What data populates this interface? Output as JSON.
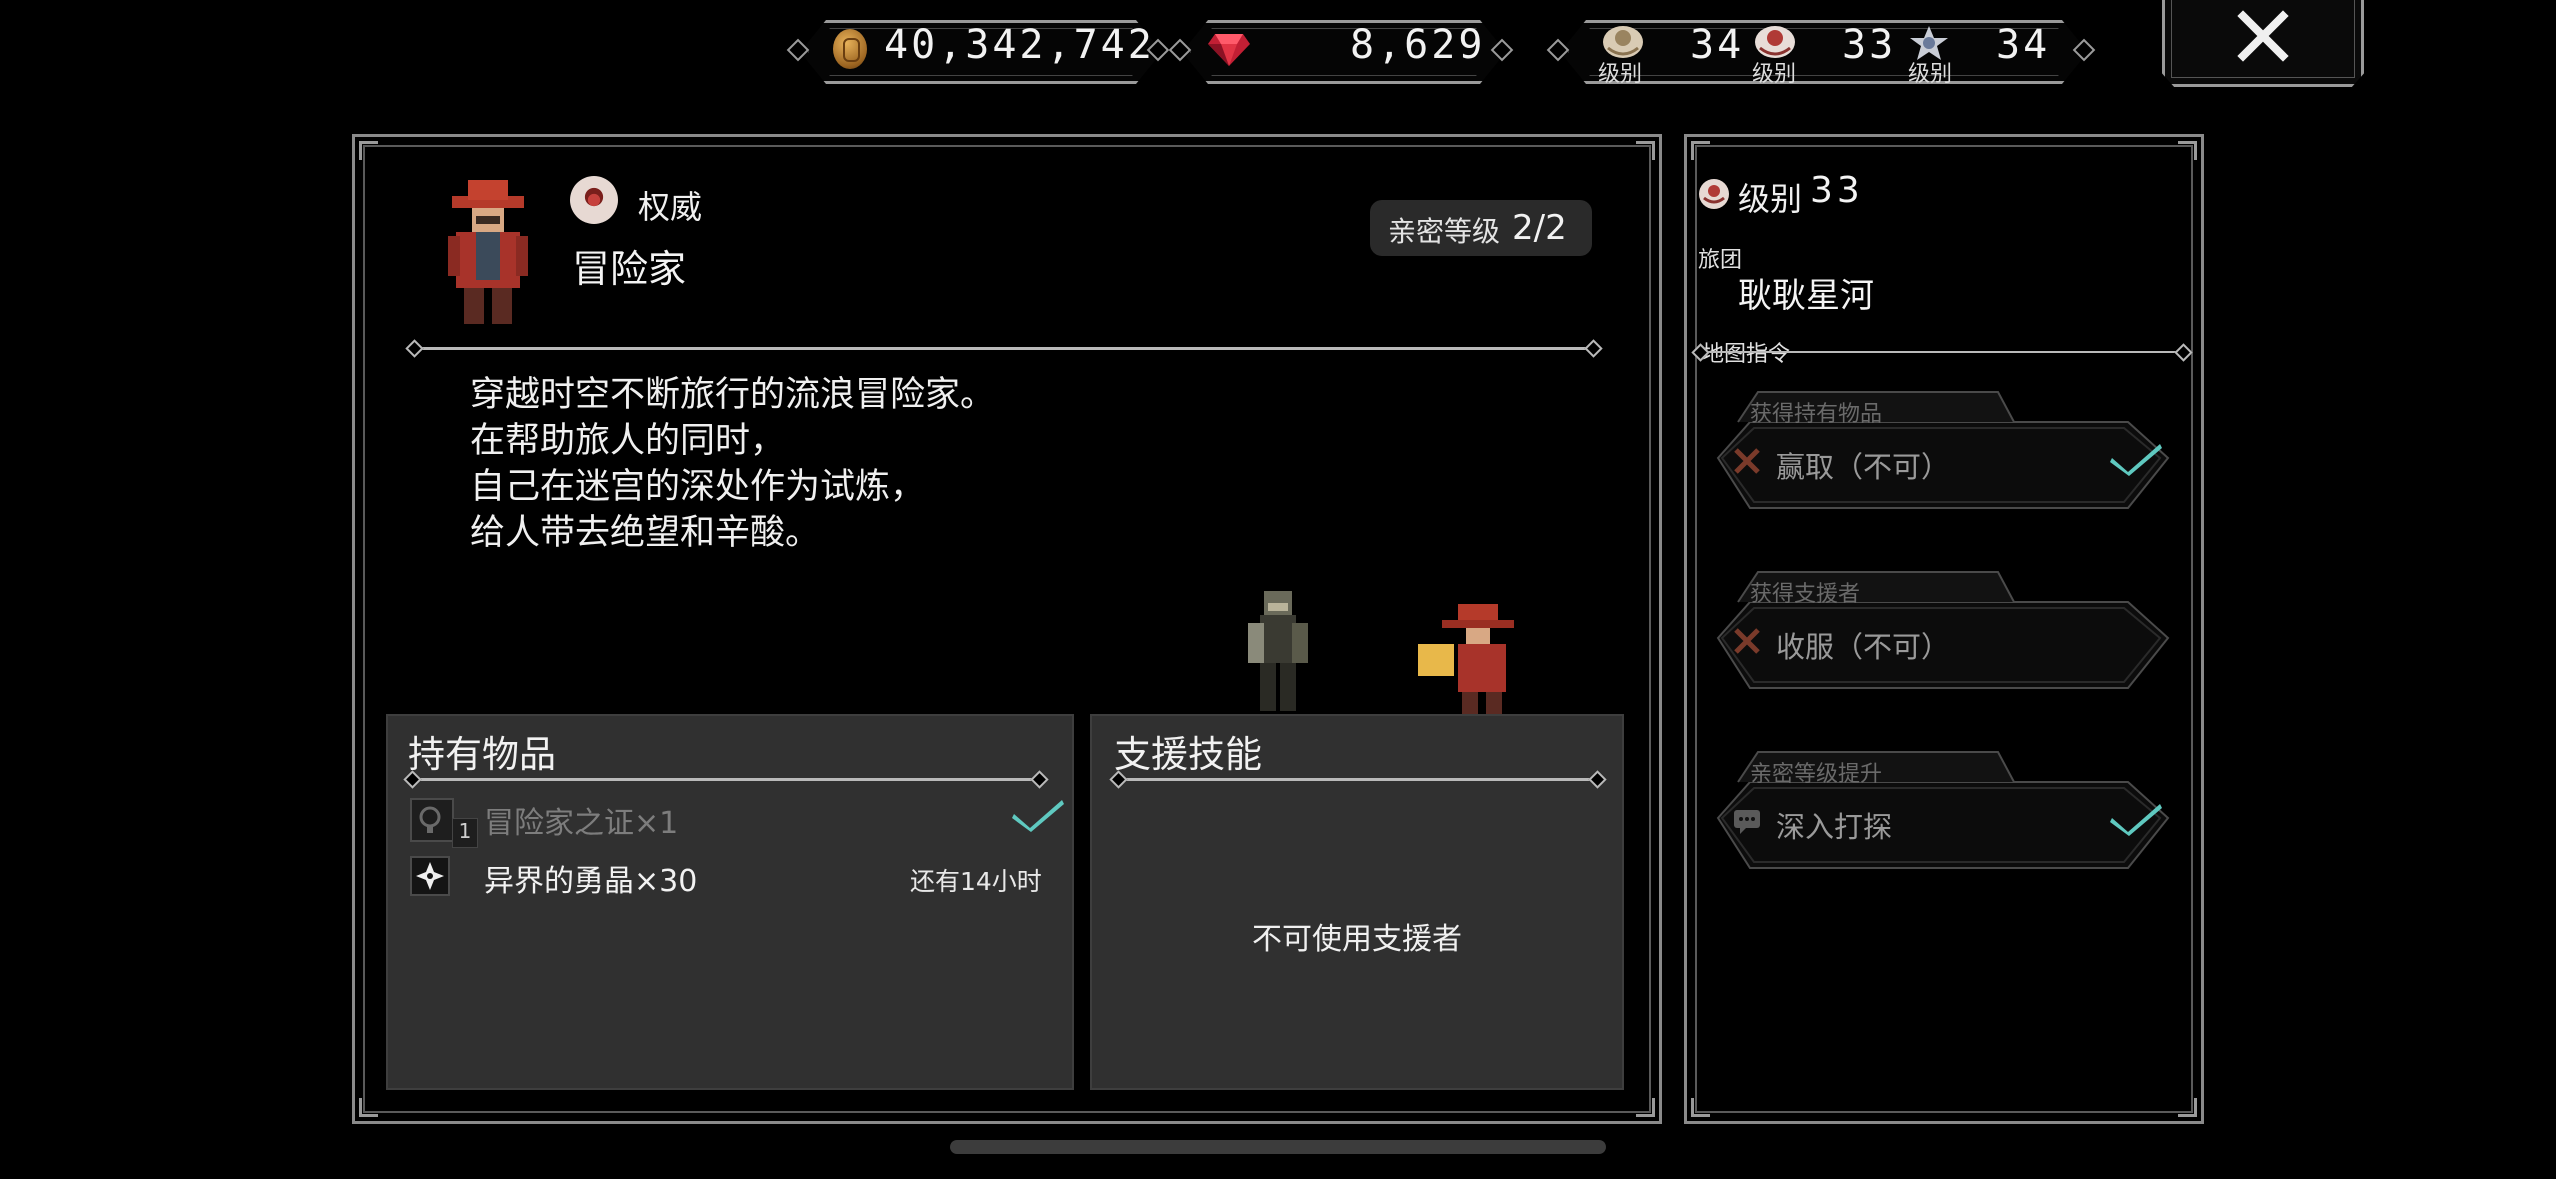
{
  "top_bar": {
    "gold": "40,342,742",
    "gems": "8,629",
    "ranks": [
      {
        "icon": "crest-tan-icon",
        "caption": "级别",
        "value": "34"
      },
      {
        "icon": "crest-red-icon",
        "caption": "级别",
        "value": "33"
      },
      {
        "icon": "crest-silver-icon",
        "caption": "级别",
        "value": "34"
      }
    ]
  },
  "character": {
    "class_label": "权威",
    "name": "冒险家",
    "affinity_label": "亲密等级",
    "affinity_value": "2/2",
    "description": [
      "穿越时空不断旅行的流浪冒险家。",
      "在帮助旅人的同时，",
      "自己在迷宫的深处作为试炼，",
      "给人带去绝望和辛酸。"
    ]
  },
  "items_panel": {
    "title": "持有物品",
    "items": [
      {
        "name": "冒险家之证×1",
        "count": "1",
        "status": "",
        "obtained": true
      },
      {
        "name": "异界的勇晶×30",
        "count": "",
        "status": "还有14小时",
        "obtained": false
      }
    ]
  },
  "support_panel": {
    "title": "支援技能",
    "empty_text": "不可使用支援者"
  },
  "side_panel": {
    "level_label": "级别",
    "level_value": "33",
    "guild_label": "旅团",
    "guild_name": "耿耿星河",
    "map_cmd_label": "地图指令",
    "commands": [
      {
        "tab": "获得持有物品",
        "text": "赢取（不可）",
        "icon": "crossed-swords-icon",
        "done": true
      },
      {
        "tab": "获得支援者",
        "text": "收服（不可）",
        "icon": "crossed-swords-icon",
        "done": false
      },
      {
        "tab": "亲密等级提升",
        "text": "深入打探",
        "icon": "chat-bubble-icon",
        "done": true
      }
    ]
  },
  "colors": {
    "check": "#5fc9c0",
    "panel_fill": "#303030",
    "frame": "#8a8a8a"
  }
}
